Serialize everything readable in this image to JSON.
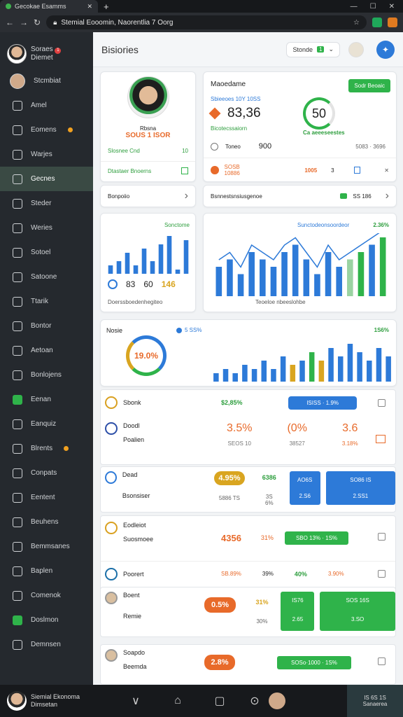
{
  "browser": {
    "tab_title": "Gecokae Esamms",
    "url": "Stemial Eooomin, Naorentlia 7 Oorg"
  },
  "sidebar": {
    "profile": {
      "name_line1": "Soraes",
      "name_line2": "Diemet",
      "badge": "1"
    },
    "items": [
      {
        "label": "Stcmbiat"
      },
      {
        "label": "Amel"
      },
      {
        "label": "Eomens"
      },
      {
        "label": "Warjes"
      },
      {
        "label": "Gecnes"
      },
      {
        "label": "Steder"
      },
      {
        "label": "Weries"
      },
      {
        "label": "Sotoel"
      },
      {
        "label": "Satoone"
      },
      {
        "label": "Ttarik"
      },
      {
        "label": "Bontor"
      },
      {
        "label": "Aetoan"
      },
      {
        "label": "Bonlojens"
      },
      {
        "label": "Eenan"
      },
      {
        "label": "Eanquiz"
      },
      {
        "label": "Blrents"
      },
      {
        "label": "Conpats"
      },
      {
        "label": "Eentent"
      },
      {
        "label": "Beuhens"
      },
      {
        "label": "Bemmsanes"
      },
      {
        "label": "Baplen"
      },
      {
        "label": "Comenok"
      },
      {
        "label": "Doslmon"
      },
      {
        "label": "Demnsen"
      }
    ]
  },
  "header": {
    "title": "Bisiories",
    "select_label": "Stonde",
    "select_badge": "1"
  },
  "profile_card": {
    "name": "Rbsna",
    "subtitle": "SOUS 1 ISOR",
    "row1_label": "Slosnee Cnd",
    "row1_value": "10",
    "row2_label": "Dtastaer Bnoerns"
  },
  "stats_card": {
    "title": "Maoedame",
    "top_tag": "Sodr Beoaic",
    "subtitle": "Sbieeoes 10Y 10SS",
    "main_value": "83,36",
    "small_line": "Bicotecssaiorn",
    "ring_value": "50",
    "ring_caption": "Ca aeeeseestes",
    "row1_a": "Toneo",
    "row1_b": "900",
    "row1_c": "5083 · 3696",
    "row2_a": "SOSB 10886",
    "row2_b": "1005",
    "row2_c": "3"
  },
  "links": [
    {
      "label": "Bonpoiio"
    },
    {
      "label": "Bsnnestsnsiusgenoe",
      "value": "SS 186"
    }
  ],
  "bar_card_left": {
    "top_label": "Sonctome",
    "v1": "83",
    "v2": "60",
    "v3": "146",
    "footer": "Doerssboedenhegiteo"
  },
  "combo_card": {
    "top_label": "Sunctodeonsoordeor",
    "top_value": "2.36%",
    "footer": "Teoeloe nbeeslohbe"
  },
  "donut_card": {
    "title": "Nosie",
    "tag": "5 SS%",
    "ring_value": "19.0%",
    "right_value": "1S6%"
  },
  "rows": [
    {
      "name": "Sbonk",
      "sub": "",
      "pct": "$2,85%",
      "btn": "ISISS · 1.9%"
    },
    {
      "name": "Doodl",
      "sub": "Poalien",
      "v1": "3.5%",
      "v2": "(0%",
      "v3": "3.6",
      "s1": "SEOS 10",
      "s2": "38527",
      "s3": "3.18%"
    },
    {
      "name": "Dead",
      "sub": "Bsonsiser",
      "pill": "4.95%",
      "v": "6386",
      "b1": "AO6S",
      "b1s": "2.S6",
      "b2": "SO86 IS",
      "b2s": "2.SS1",
      "s1": "5886 TS",
      "s2": "3S 6%"
    },
    {
      "name": "Eodleiot",
      "sub": "Suosmoee",
      "v1": "4356",
      "v2": "31%",
      "btn": "SBO 13% · 1S%"
    },
    {
      "name": "Poorert",
      "sub": "",
      "v1": "SB.89%",
      "v2": "39%",
      "v3": "40%",
      "v4": "3.90%"
    },
    {
      "name": "Boent",
      "sub": "Remie",
      "pill": "0.5%",
      "v": "31%",
      "b1": "IS76",
      "b1s": "2.65",
      "b2": "SOS 16S",
      "b2s": "3.SO",
      "s2": "30%"
    },
    {
      "name": "Soapdo",
      "sub": "Beemda",
      "pill": "2.8%",
      "btn": "SOSo·1000 · 1S%"
    }
  ],
  "bottom": {
    "name_line1": "Siemial Ekonoma",
    "name_line2": "Dimsetan",
    "right1": "IS 6S 1S",
    "right2": "Sanaerea"
  },
  "chart_data": [
    {
      "type": "bar",
      "values": [
        2,
        3,
        5,
        2,
        6,
        3,
        7,
        9,
        1,
        8
      ]
    },
    {
      "type": "bar",
      "values": [
        4,
        5,
        3,
        6,
        5,
        4,
        6,
        7,
        5,
        3,
        6,
        4,
        5,
        6,
        7,
        8
      ]
    },
    {
      "type": "bar",
      "values": [
        2,
        3,
        2,
        4,
        3,
        5,
        3,
        6,
        4,
        5,
        7,
        5,
        8,
        6,
        9,
        7,
        5,
        8,
        6
      ]
    }
  ],
  "colors": {
    "accent": "#2d7ad8",
    "green": "#2fb34a",
    "orange": "#e86a2a",
    "yellow": "#d9a520"
  }
}
